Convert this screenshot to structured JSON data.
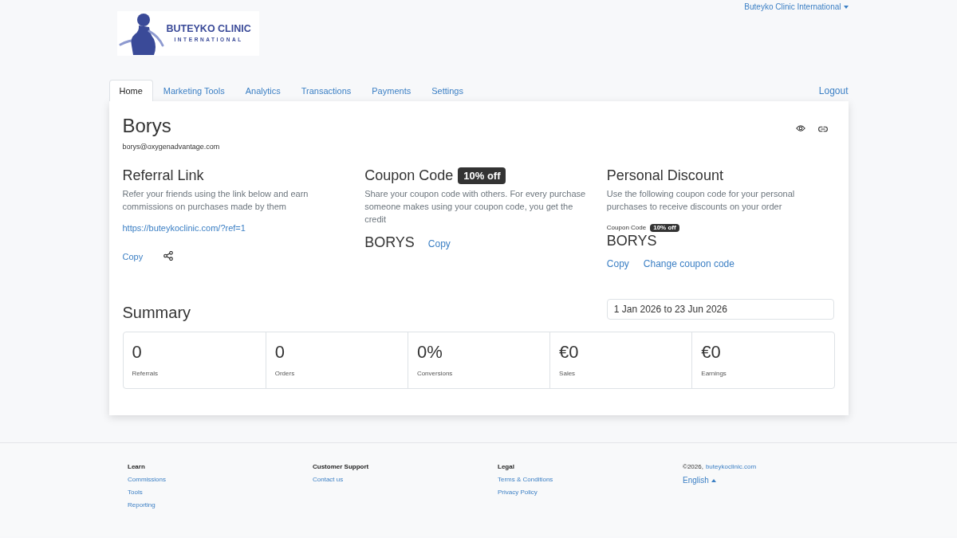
{
  "header": {
    "logo": {
      "title": "BUTEYKO CLINIC",
      "subtitle": "INTERNATIONAL"
    },
    "account_menu": "Buteyko Clinic International"
  },
  "tabs": [
    {
      "label": "Home",
      "selected": true
    },
    {
      "label": "Marketing Tools",
      "selected": false
    },
    {
      "label": "Analytics",
      "selected": false
    },
    {
      "label": "Transactions",
      "selected": false
    },
    {
      "label": "Payments",
      "selected": false
    },
    {
      "label": "Settings",
      "selected": false
    }
  ],
  "logout": "Logout",
  "profile": {
    "name": "Borys",
    "email": "borys@oxygenadvantage.com"
  },
  "referral_link": {
    "title": "Referral Link",
    "description": "Refer your friends using the link below and earn commissions on purchases made by them",
    "url": "https://buteykoclinic.com/?ref=1",
    "copy": "Copy"
  },
  "coupon_code": {
    "title": "Coupon Code",
    "badge": "10% off",
    "description": "Share your coupon code with others. For every purchase someone makes using your coupon code, you get the credit",
    "code": "BORYS",
    "copy": "Copy"
  },
  "personal_discount": {
    "title": "Personal Discount",
    "description": "Use the following coupon code for your personal purchases to receive discounts on your order",
    "code_label": "Coupon Code",
    "badge": "10% off",
    "code": "BORYS",
    "actions": [
      "Copy",
      "Change coupon code"
    ]
  },
  "summary": {
    "title": "Summary",
    "date_range": {
      "value": "1 Jan 2026 to 23 Jun 2026"
    },
    "stats": [
      {
        "value": "0",
        "label": "Referrals"
      },
      {
        "value": "0",
        "label": "Orders"
      },
      {
        "value": "0%",
        "label": "Conversions"
      },
      {
        "value": "€0",
        "label": "Sales"
      },
      {
        "value": "€0",
        "label": "Earnings"
      }
    ]
  },
  "footer": {
    "columns": [
      {
        "heading": "Learn",
        "links": [
          "Commissions",
          "Tools",
          "Reporting"
        ]
      },
      {
        "heading": "Customer Support",
        "links": [
          "Contact us"
        ]
      },
      {
        "heading": "Legal",
        "links": [
          "Terms & Conditions",
          "Privacy Policy"
        ]
      }
    ],
    "copyright": "©2026,",
    "site_link": "buteykoclinic.com",
    "language": "English"
  }
}
